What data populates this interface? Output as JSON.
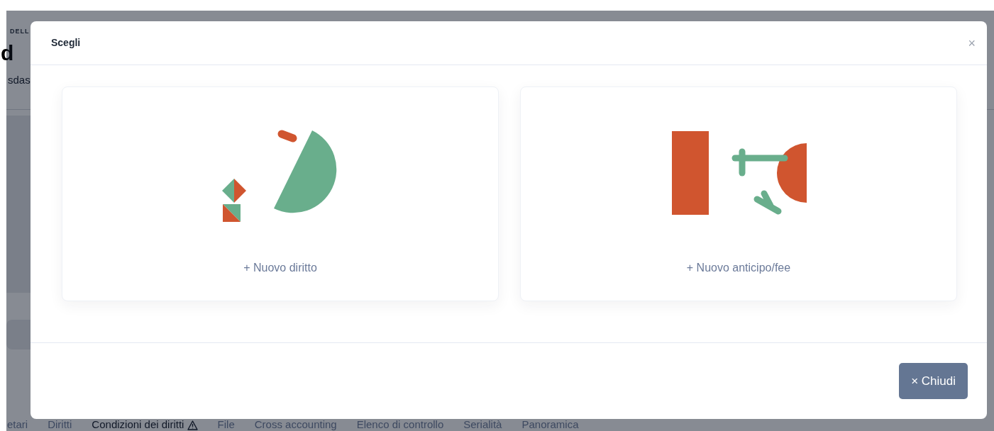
{
  "background": {
    "eyebrow": "DELL",
    "title": "d",
    "subtitle": "sdas",
    "tabs": [
      {
        "label": "etari",
        "selected": false,
        "warning": false
      },
      {
        "label": "Diritti",
        "selected": false,
        "warning": false
      },
      {
        "label": "Condizioni dei diritti",
        "selected": true,
        "warning": true
      },
      {
        "label": "File",
        "selected": false,
        "warning": false
      },
      {
        "label": "Cross accounting",
        "selected": false,
        "warning": false
      },
      {
        "label": "Elenco di controllo",
        "selected": false,
        "warning": false
      },
      {
        "label": "Serialità",
        "selected": false,
        "warning": false
      },
      {
        "label": "Panoramica",
        "selected": false,
        "warning": false
      }
    ]
  },
  "dialog": {
    "title": "Scegli",
    "close": "×",
    "options": [
      {
        "kind": "shapes-circle",
        "label": "+ Nuovo diritto"
      },
      {
        "kind": "shapes-rect",
        "label": "+ Nuovo anticipo/fee"
      }
    ],
    "buttons": [
      {
        "label": "× Chiudi"
      }
    ]
  }
}
